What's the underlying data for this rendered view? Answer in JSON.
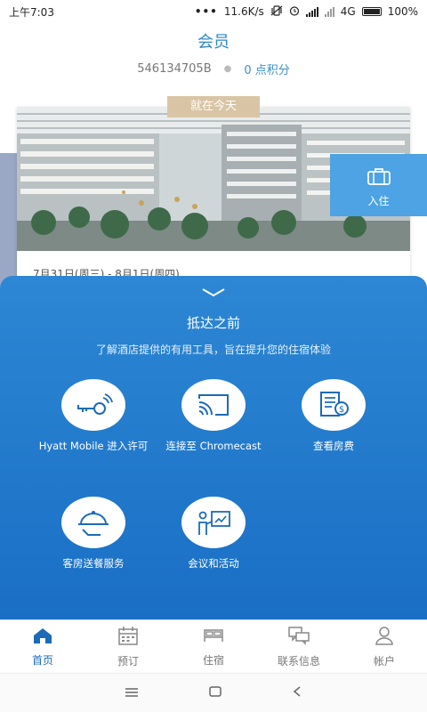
{
  "status_bar": {
    "time": "上午7:03",
    "speed": "11.6K/s",
    "network": "4G",
    "battery": "100%"
  },
  "header": {
    "title": "会员",
    "member_id": "546134705B",
    "points": "0 点积分"
  },
  "reservation": {
    "badge": "就在今天",
    "dates": "7月31日(周三) - 8月1日(周四)",
    "checkin_label": "入住"
  },
  "panel": {
    "title": "抵达之前",
    "description": "了解酒店提供的有用工具，旨在提升您的住宿体验",
    "tools": [
      {
        "label": "Hyatt Mobile 进入许可",
        "icon": "key-icon"
      },
      {
        "label": "连接至 Chromecast",
        "icon": "cast-icon"
      },
      {
        "label": "查看房费",
        "icon": "bill-icon"
      },
      {
        "label": "客房送餐服务",
        "icon": "room-service-icon"
      },
      {
        "label": "会议和活动",
        "icon": "presentation-icon"
      }
    ]
  },
  "tabbar": {
    "items": [
      {
        "label": "首页",
        "icon": "home-icon",
        "active": true
      },
      {
        "label": "预订",
        "icon": "calendar-icon",
        "active": false
      },
      {
        "label": "住宿",
        "icon": "bed-icon",
        "active": false
      },
      {
        "label": "联系信息",
        "icon": "chat-icon",
        "active": false
      },
      {
        "label": "帐户",
        "icon": "user-icon",
        "active": false
      }
    ]
  },
  "colors": {
    "accent": "#1b6bb8",
    "panel": "#2b84d2",
    "badge": "#d9c5a5"
  }
}
